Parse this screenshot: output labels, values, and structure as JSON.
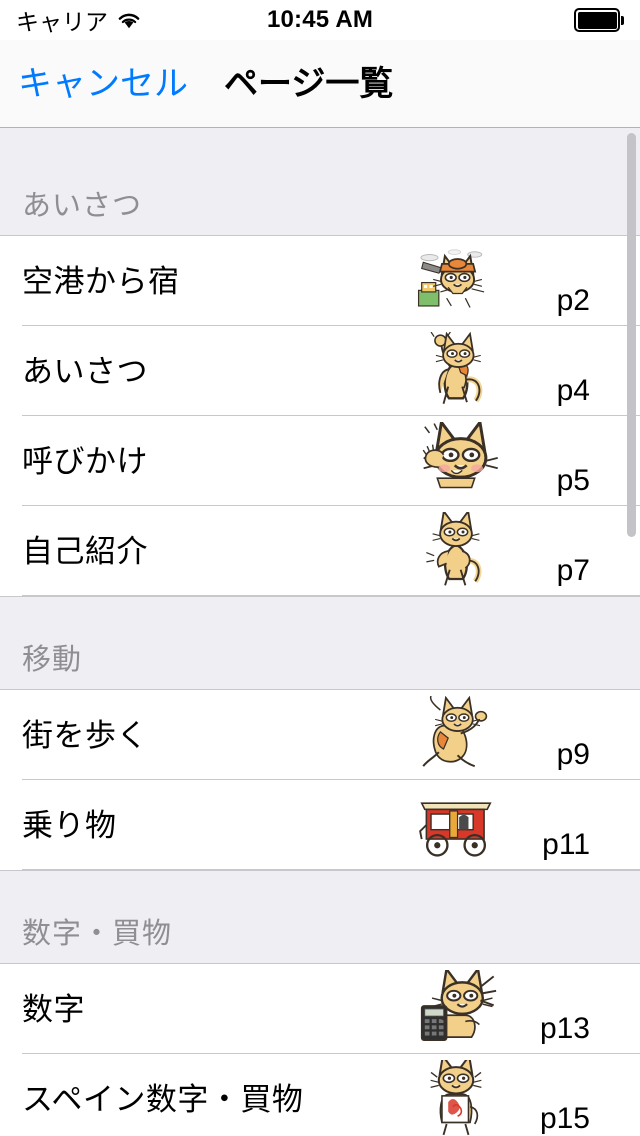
{
  "status_bar": {
    "carrier": "キャリア",
    "wifi_icon": "wifi-icon",
    "time": "10:45 AM",
    "battery_icon": "battery-full-icon"
  },
  "nav_bar": {
    "cancel_label": "キャンセル",
    "title": "ページ一覧"
  },
  "accent_color": "#007AFF",
  "section_header_bg": "#EEEEF3",
  "section_title_color": "#8E8E93",
  "sections": [
    {
      "title": "あいさつ",
      "rows": [
        {
          "title": "空港から宿",
          "page": "p2",
          "thumb": "cat-airport-icon"
        },
        {
          "title": "あいさつ",
          "page": "p4",
          "thumb": "cat-waving-icon"
        },
        {
          "title": "呼びかけ",
          "page": "p5",
          "thumb": "cat-calling-icon"
        },
        {
          "title": "自己紹介",
          "page": "p7",
          "thumb": "cat-introducing-icon"
        }
      ]
    },
    {
      "title": "移動",
      "rows": [
        {
          "title": "街を歩く",
          "page": "p9",
          "thumb": "cat-walking-icon"
        },
        {
          "title": "乗り物",
          "page": "p11",
          "thumb": "rickshaw-icon"
        }
      ]
    },
    {
      "title": "数字・買物",
      "rows": [
        {
          "title": "数字",
          "page": "p13",
          "thumb": "cat-calculator-icon"
        },
        {
          "title": "スペイン数字・買物",
          "page": "p15",
          "thumb": "cat-shopping-icon"
        }
      ]
    }
  ]
}
